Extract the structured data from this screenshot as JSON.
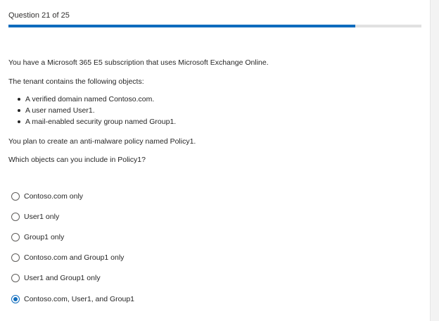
{
  "header": {
    "counter": "Question 21 of 25",
    "progress_fraction": 0.84
  },
  "question": {
    "intro": "You have a Microsoft 365 E5 subscription that uses Microsoft Exchange Online.",
    "tenant_line": "The tenant contains the following objects:",
    "objects": [
      "A verified domain named Contoso.com.",
      "A user named User1.",
      "A mail-enabled security group named Group1."
    ],
    "plan": "You plan to create an anti-malware policy named Policy1.",
    "prompt": "Which objects can you include in Policy1?"
  },
  "options": [
    {
      "label": "Contoso.com only",
      "selected": false
    },
    {
      "label": "User1 only",
      "selected": false
    },
    {
      "label": "Group1 only",
      "selected": false
    },
    {
      "label": "Contoso.com and Group1 only",
      "selected": false
    },
    {
      "label": "User1 and Group1 only",
      "selected": false
    },
    {
      "label": "Contoso.com, User1, and Group1",
      "selected": true
    }
  ],
  "colors": {
    "accent": "#0f6cbd",
    "track": "#e1e1e1"
  }
}
